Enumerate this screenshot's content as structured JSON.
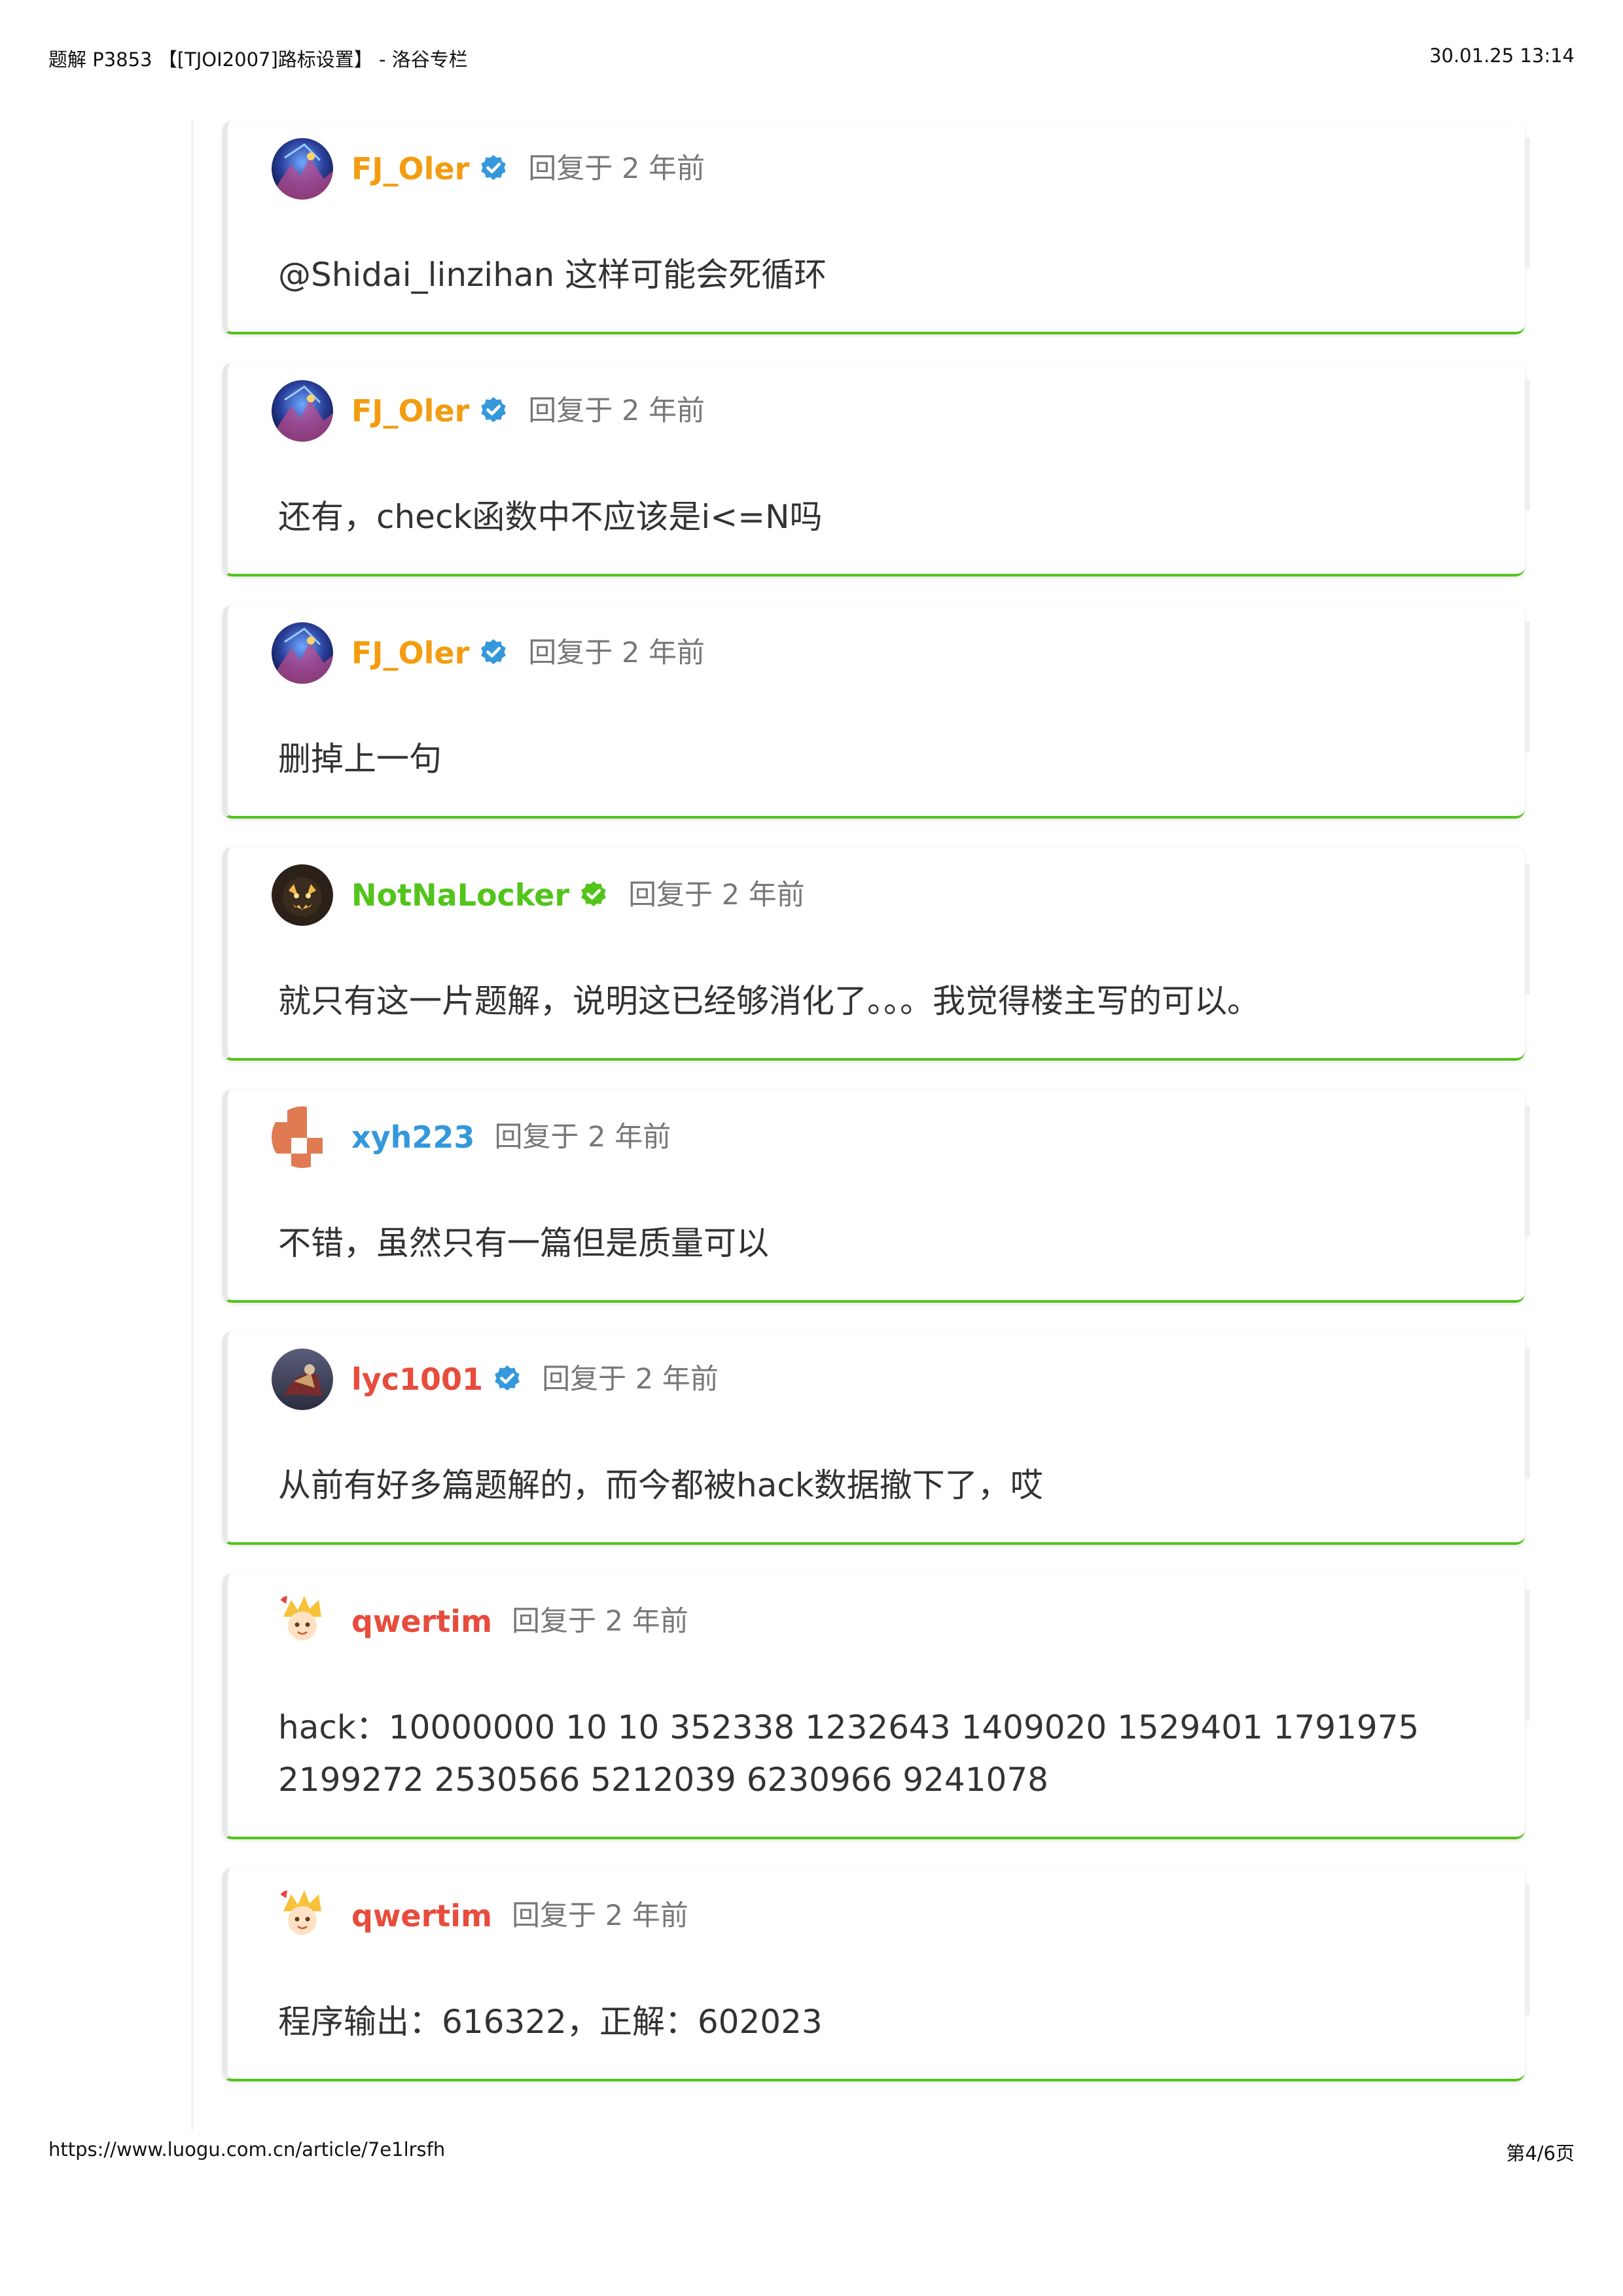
{
  "print_header": {
    "title": "题解 P3853 【[TJOI2007]路标设置】 - 洛谷专栏",
    "datetime": "30.01.25 13:14"
  },
  "print_footer": {
    "url": "https://www.luogu.com.cn/article/7e1lrsfh",
    "page": "第4/6页"
  },
  "colors": {
    "orange": "#f39c11",
    "green": "#52c41a",
    "blue": "#3498db",
    "red": "#e74c3c",
    "gray_meta": "#777777",
    "check_blue": "#3498db",
    "check_green": "#52c41a"
  },
  "comments": [
    {
      "user": "FJ_Oler",
      "name_color": "#f39c11",
      "badge": "check-blue",
      "avatar": "avatar-fj",
      "meta": "回复于 2 年前",
      "text": "@Shidai_linzihan 这样可能会死循环"
    },
    {
      "user": "FJ_Oler",
      "name_color": "#f39c11",
      "badge": "check-blue",
      "avatar": "avatar-fj",
      "meta": "回复于 2 年前",
      "text": "还有，check函数中不应该是i<=N吗"
    },
    {
      "user": "FJ_Oler",
      "name_color": "#f39c11",
      "badge": "check-blue",
      "avatar": "avatar-fj",
      "meta": "回复于 2 年前",
      "text": "删掉上一句"
    },
    {
      "user": "NotNaLocker",
      "name_color": "#52c41a",
      "badge": "check-green",
      "avatar": "avatar-notna",
      "meta": "回复于 2 年前",
      "text": "就只有这一片题解，说明这已经够消化了。。。我觉得楼主写的可以。"
    },
    {
      "user": "xyh223",
      "name_color": "#3498db",
      "badge": "none",
      "avatar": "avatar-xyh",
      "meta": "回复于 2 年前",
      "text": "不错，虽然只有一篇但是质量可以"
    },
    {
      "user": "lyc1001",
      "name_color": "#e74c3c",
      "badge": "check-blue",
      "avatar": "avatar-lyc",
      "meta": "回复于 2 年前",
      "text": "从前有好多篇题解的，而今都被hack数据撤下了，哎"
    },
    {
      "user": "qwertim",
      "name_color": "#e74c3c",
      "badge": "none",
      "avatar": "avatar-qwertim",
      "meta": "回复于 2 年前",
      "text": "hack：10000000 10 10 352338 1232643 1409020 1529401 1791975 2199272 2530566 5212039 6230966 9241078"
    },
    {
      "user": "qwertim",
      "name_color": "#e74c3c",
      "badge": "none",
      "avatar": "avatar-qwertim",
      "meta": "回复于 2 年前",
      "text": "程序输出：616322，正解：602023"
    }
  ]
}
